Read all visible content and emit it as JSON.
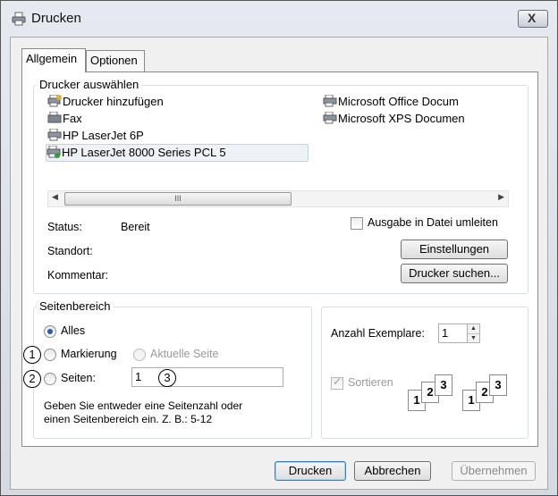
{
  "window": {
    "title": "Drucken",
    "close_label": "X"
  },
  "tabs": [
    {
      "label": "Allgemein"
    },
    {
      "label": "Optionen"
    }
  ],
  "printer_group": {
    "label": "Drucker auswählen",
    "printers": [
      {
        "name": "Drucker hinzufügen",
        "icon": "add-printer-icon"
      },
      {
        "name": "Fax",
        "icon": "fax-icon"
      },
      {
        "name": "HP LaserJet 6P",
        "icon": "printer-icon"
      },
      {
        "name": "HP LaserJet 8000 Series PCL 5",
        "icon": "default-printer-icon",
        "selected": true
      },
      {
        "name": "Microsoft Office Docum",
        "icon": "printer-icon"
      },
      {
        "name": "Microsoft XPS Documen",
        "icon": "printer-icon"
      }
    ],
    "scroll_thumb": "III",
    "status_label": "Status:",
    "status_value": "Bereit",
    "location_label": "Standort:",
    "comment_label": "Kommentar:",
    "print_to_file_label": "Ausgabe in Datei umleiten",
    "settings_button": "Einstellungen",
    "find_printer_button": "Drucker suchen..."
  },
  "page_range": {
    "label": "Seitenbereich",
    "all_label": "Alles",
    "selection_label": "Markierung",
    "current_page_label": "Aktuelle Seite",
    "pages_label": "Seiten:",
    "pages_value": "1",
    "hint": [
      "Geben Sie entweder eine Seitenzahl oder",
      "einen Seitenbereich ein. Z. B.: 5-12"
    ],
    "selected_option": "Alles"
  },
  "copies": {
    "label": "Anzahl Exemplare:",
    "value": "1",
    "collate_label": "Sortieren",
    "collate_checked": true,
    "collate_disabled": true,
    "page_numbers": [
      "1",
      "2",
      "3"
    ]
  },
  "annotations": [
    "1",
    "2",
    "3"
  ],
  "buttons": {
    "print": "Drucken",
    "cancel": "Abbrechen",
    "apply": "Übernehmen"
  },
  "colors": {
    "accent": "#2a5fa8",
    "window_bg": "#d4d9e2",
    "panel_bg": "#ffffff"
  }
}
